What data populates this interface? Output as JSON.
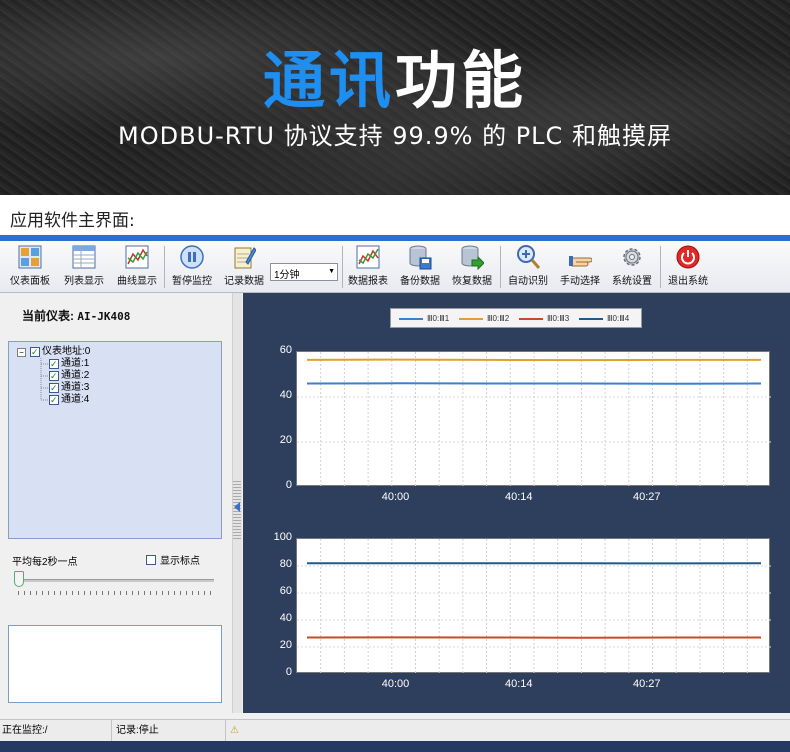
{
  "banner": {
    "title_highlight": "通讯",
    "title_rest": "功能",
    "subtitle": "MODBU-RTU 协议支持 99.9% 的 PLC 和触摸屏"
  },
  "section_label": "应用软件主界面:",
  "toolbar": {
    "buttons": [
      {
        "label": "仪表面板",
        "icon": "panel-grid-icon"
      },
      {
        "label": "列表显示",
        "icon": "list-table-icon"
      },
      {
        "label": "曲线显示",
        "icon": "curve-chart-icon"
      },
      {
        "label": "暂停监控",
        "icon": "pause-icon"
      },
      {
        "label": "记录数据",
        "icon": "notepad-pencil-icon"
      },
      {
        "label": "数据报表",
        "icon": "report-chart-icon"
      },
      {
        "label": "备份数据",
        "icon": "database-save-icon"
      },
      {
        "label": "恢复数据",
        "icon": "database-restore-icon"
      },
      {
        "label": "自动识别",
        "icon": "magnifier-icon"
      },
      {
        "label": "手动选择",
        "icon": "hand-pointer-icon"
      },
      {
        "label": "系统设置",
        "icon": "gear-icon"
      },
      {
        "label": "退出系统",
        "icon": "power-icon"
      }
    ],
    "interval_select": "1分钟"
  },
  "left_panel": {
    "current_meter_label": "当前仪表:",
    "current_meter_value": "AI-JK408",
    "tree": {
      "root": "仪表地址:0",
      "channels": [
        "通道:1",
        "通道:2",
        "通道:3",
        "通道:4"
      ]
    },
    "avg_label": "平均每2秒一点",
    "show_points_label": "显示标点",
    "slider_position": 0
  },
  "legend": [
    {
      "name": "Ⅲ0:Ⅲ1",
      "color": "#3a7fd0"
    },
    {
      "name": "Ⅲ0:Ⅲ2",
      "color": "#e0a030"
    },
    {
      "name": "Ⅲ0:Ⅲ3",
      "color": "#c84a2a"
    },
    {
      "name": "Ⅲ0:Ⅲ4",
      "color": "#1f5a8c"
    }
  ],
  "chart_data": [
    {
      "type": "line",
      "ylim": [
        0,
        60
      ],
      "yticks": [
        "60",
        "40",
        "20",
        "0"
      ],
      "xticks": [
        "40:00",
        "40:14",
        "40:27"
      ],
      "series": [
        {
          "name": "Ⅲ0:Ⅲ2",
          "color": "#e0a030",
          "values": [
            56.5,
            56.6,
            56.5,
            56.4,
            56.5,
            56.5
          ]
        },
        {
          "name": "Ⅲ0:Ⅲ1",
          "color": "#3a7fd0",
          "values": [
            46.0,
            46.1,
            46.0,
            46.0,
            45.9,
            46.0
          ]
        }
      ]
    },
    {
      "type": "line",
      "ylim": [
        0,
        100
      ],
      "yticks": [
        "100",
        "80",
        "60",
        "40",
        "20",
        "0"
      ],
      "xticks": [
        "40:00",
        "40:14",
        "40:27"
      ],
      "series": [
        {
          "name": "Ⅲ0:Ⅲ4",
          "color": "#1f5a8c",
          "values": [
            82.0,
            82.1,
            82.0,
            82.0,
            81.9,
            82.0
          ]
        },
        {
          "name": "Ⅲ0:Ⅲ3",
          "color": "#c84a2a",
          "values": [
            27.0,
            27.1,
            27.0,
            26.9,
            27.0,
            27.0
          ]
        }
      ]
    }
  ],
  "statusbar": {
    "monitoring": "正在监控:/",
    "record": "记录:停止"
  }
}
